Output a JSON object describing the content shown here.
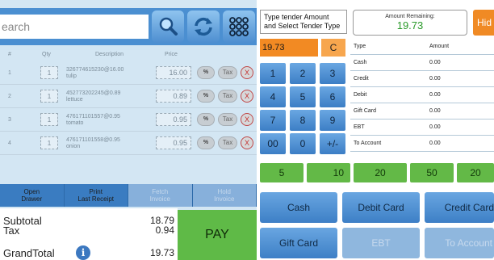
{
  "search": {
    "placeholder": "Search",
    "value": "earch"
  },
  "toolbar": {
    "search_icon": "magnifier-icon",
    "refresh_icon": "refresh-icon",
    "grid_icon": "grid-icon"
  },
  "table": {
    "headers": {
      "num": "#",
      "qty": "Qty",
      "description": "Description",
      "price": "Price"
    },
    "rows": [
      {
        "num": "1",
        "qty": "1",
        "code": "326774615230@16.00",
        "name": "tulip",
        "price": "16.00",
        "pct": "%",
        "tax": "Tax",
        "del": "X"
      },
      {
        "num": "2",
        "qty": "1",
        "code": "452773202245@0.89",
        "name": "lettuce",
        "price": "0.89",
        "pct": "%",
        "tax": "Tax",
        "del": "X"
      },
      {
        "num": "3",
        "qty": "1",
        "code": "476171101557@0.95",
        "name": "tomato",
        "price": "0.95",
        "pct": "%",
        "tax": "Tax",
        "del": "X"
      },
      {
        "num": "4",
        "qty": "1",
        "code": "476171101558@0.95",
        "name": "onion",
        "price": "0.95",
        "pct": "%",
        "tax": "Tax",
        "del": "X"
      }
    ]
  },
  "actions": [
    {
      "line1": "Open",
      "line2": "Drawer",
      "enabled": true
    },
    {
      "line1": "Print",
      "line2": "Last Receipt",
      "enabled": true
    },
    {
      "line1": "Fetch",
      "line2": "Invoice",
      "enabled": false
    },
    {
      "line1": "Hold",
      "line2": "Invoice",
      "enabled": false
    }
  ],
  "totals": {
    "subtotal_label": "Subtotal",
    "subtotal": "18.79",
    "tax_label": "Tax",
    "tax": "0.94",
    "grand_label": "GrandTotal",
    "grand": "19.73"
  },
  "pay_label": "PAY",
  "tender": {
    "hint": "Type tender Amount and Select Tender Type",
    "remaining_label": "Amount Remaining:",
    "remaining": "19.73",
    "hide_label": "Hid",
    "amount": "19.73",
    "clear": "C",
    "keys": [
      "1",
      "2",
      "3",
      "4",
      "5",
      "6",
      "7",
      "8",
      "9",
      "00",
      "0",
      "+/-"
    ],
    "table_headers": {
      "type": "Type",
      "amount": "Amount"
    },
    "table_rows": [
      {
        "type": "Cash",
        "amount": "0.00"
      },
      {
        "type": "Credit",
        "amount": "0.00"
      },
      {
        "type": "Debit",
        "amount": "0.00"
      },
      {
        "type": "Gift Card",
        "amount": "0.00"
      },
      {
        "type": "EBT",
        "amount": "0.00"
      },
      {
        "type": "To Account",
        "amount": "0.00"
      }
    ],
    "quick": [
      "5",
      "10",
      "20",
      "50",
      "20"
    ],
    "buttons": [
      {
        "label": "Cash",
        "enabled": true
      },
      {
        "label": "Debit Card",
        "enabled": true
      },
      {
        "label": "Credit Card",
        "enabled": true
      },
      {
        "label": "Gift Card",
        "enabled": true
      },
      {
        "label": "EBT",
        "enabled": false
      },
      {
        "label": "To Account",
        "enabled": false
      }
    ]
  },
  "colors": {
    "pay_green": "#5fba47",
    "accent_blue": "#3a7cc1",
    "orange": "#f28a23",
    "remaining_green": "#2a9a2a"
  }
}
